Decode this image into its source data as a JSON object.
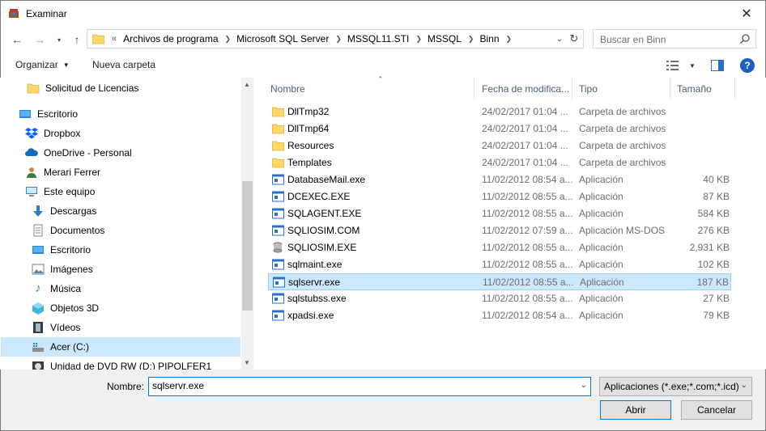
{
  "window": {
    "title": "Examinar"
  },
  "address": {
    "breadcrumb": [
      "Archivos de programa",
      "Microsoft SQL Server",
      "MSSQL11.STI",
      "MSSQL",
      "Binn"
    ],
    "search_placeholder": "Buscar en Binn"
  },
  "toolbar": {
    "organize": "Organizar",
    "new_folder": "Nueva carpeta"
  },
  "sidebar": {
    "items": [
      {
        "label": "Solicitud de Licencias",
        "icon": "folder-icon"
      },
      {
        "label": "Escritorio",
        "icon": "desktop-icon"
      },
      {
        "label": "Dropbox",
        "icon": "dropbox-icon"
      },
      {
        "label": "OneDrive - Personal",
        "icon": "onedrive-icon"
      },
      {
        "label": "Merari Ferrer",
        "icon": "user-icon"
      },
      {
        "label": "Este equipo",
        "icon": "computer-icon"
      },
      {
        "label": "Descargas",
        "icon": "download-icon"
      },
      {
        "label": "Documentos",
        "icon": "documents-icon"
      },
      {
        "label": "Escritorio",
        "icon": "desktop-icon"
      },
      {
        "label": "Imágenes",
        "icon": "pictures-icon"
      },
      {
        "label": "Música",
        "icon": "music-icon"
      },
      {
        "label": "Objetos 3D",
        "icon": "objects3d-icon"
      },
      {
        "label": "Vídeos",
        "icon": "videos-icon"
      },
      {
        "label": "Acer (C:)",
        "icon": "drive-icon"
      },
      {
        "label": "Unidad de DVD RW (D:) PIPOLFER1",
        "icon": "dvd-drive-icon"
      }
    ]
  },
  "columns": {
    "name": "Nombre",
    "date": "Fecha de modifica...",
    "type": "Tipo",
    "size": "Tamaño"
  },
  "files": [
    {
      "name": "DllTmp32",
      "date": "24/02/2017 01:04 ...",
      "type": "Carpeta de archivos",
      "size": "",
      "icon": "folder-icon"
    },
    {
      "name": "DllTmp64",
      "date": "24/02/2017 01:04 ...",
      "type": "Carpeta de archivos",
      "size": "",
      "icon": "folder-icon"
    },
    {
      "name": "Resources",
      "date": "24/02/2017 01:04 ...",
      "type": "Carpeta de archivos",
      "size": "",
      "icon": "folder-icon"
    },
    {
      "name": "Templates",
      "date": "24/02/2017 01:04 ...",
      "type": "Carpeta de archivos",
      "size": "",
      "icon": "folder-icon"
    },
    {
      "name": "DatabaseMail.exe",
      "date": "11/02/2012 08:54 a...",
      "type": "Aplicación",
      "size": "40 KB",
      "icon": "app-icon"
    },
    {
      "name": "DCEXEC.EXE",
      "date": "11/02/2012 08:55 a...",
      "type": "Aplicación",
      "size": "87 KB",
      "icon": "app-icon"
    },
    {
      "name": "SQLAGENT.EXE",
      "date": "11/02/2012 08:55 a...",
      "type": "Aplicación",
      "size": "584 KB",
      "icon": "app-icon"
    },
    {
      "name": "SQLIOSIM.COM",
      "date": "11/02/2012 07:59 a...",
      "type": "Aplicación MS-DOS",
      "size": "276 KB",
      "icon": "app-icon"
    },
    {
      "name": "SQLIOSIM.EXE",
      "date": "11/02/2012 08:55 a...",
      "type": "Aplicación",
      "size": "2,931 KB",
      "icon": "sqliosim-icon"
    },
    {
      "name": "sqlmaint.exe",
      "date": "11/02/2012 08:55 a...",
      "type": "Aplicación",
      "size": "102 KB",
      "icon": "app-icon"
    },
    {
      "name": "sqlservr.exe",
      "date": "11/02/2012 08:55 a...",
      "type": "Aplicación",
      "size": "187 KB",
      "icon": "app-icon",
      "selected": true
    },
    {
      "name": "sqlstubss.exe",
      "date": "11/02/2012 08:55 a...",
      "type": "Aplicación",
      "size": "27 KB",
      "icon": "app-icon"
    },
    {
      "name": "xpadsi.exe",
      "date": "11/02/2012 08:54 a...",
      "type": "Aplicación",
      "size": "79 KB",
      "icon": "app-icon"
    }
  ],
  "footer": {
    "name_label": "Nombre:",
    "name_value": "sqlservr.exe",
    "filter": "Aplicaciones (*.exe;*.com;*.icd)",
    "open": "Abrir",
    "cancel": "Cancelar"
  },
  "colors": {
    "selection": "#cce8ff",
    "selection_border": "#99d1ff",
    "accent": "#0078d7",
    "folder": "#ffd766"
  }
}
